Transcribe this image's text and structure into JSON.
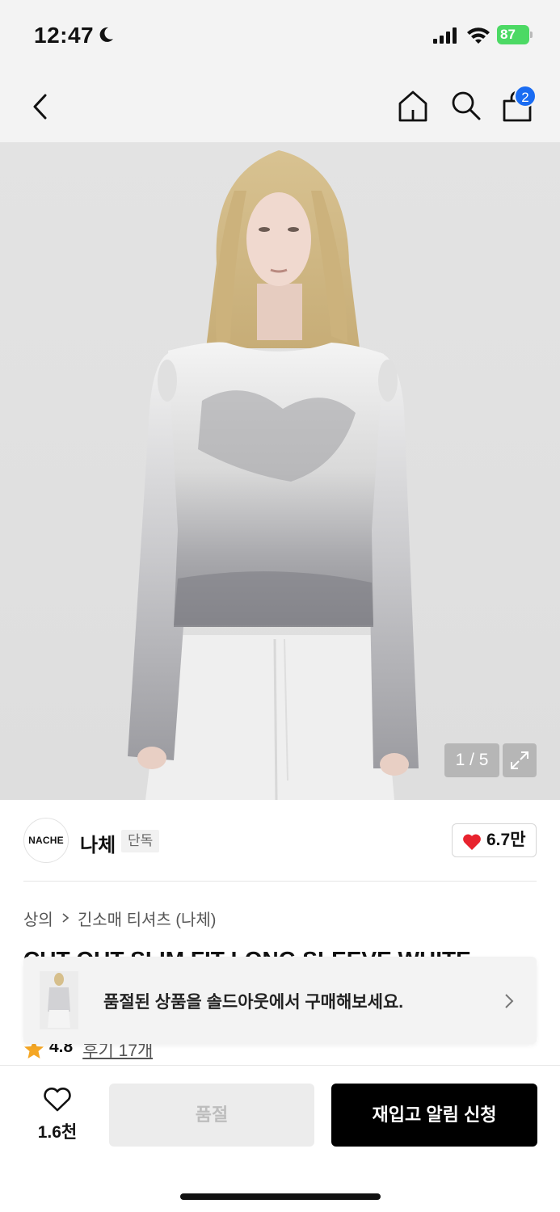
{
  "status_bar": {
    "time": "12:47",
    "battery": "87"
  },
  "nav": {
    "cart_count": "2"
  },
  "hero": {
    "pager": "1 / 5"
  },
  "brand": {
    "logo_text": "NACHE",
    "name": "나체",
    "badge": "단독",
    "like_count": "6.7만"
  },
  "breadcrumb": {
    "category": "상의",
    "subcategory": "긴소매 티셔츠 (나체)"
  },
  "product": {
    "title": "CUT-OUT SLIM FIT LONG SLEEVE WHITE",
    "rating": "4.8",
    "reviews": "후기 17개"
  },
  "soldout_banner": {
    "text": "품절된 상품을 솔드아웃에서 구매해보세요."
  },
  "bottom_bar": {
    "wish_count": "1.6천",
    "soldout_label": "품절",
    "restock_label": "재입고 알림 신청"
  },
  "colors": {
    "accent_blue": "#1a6cf2",
    "heart_red": "#e8232e",
    "star_orange": "#f5a623",
    "battery_green": "#4cd964"
  }
}
